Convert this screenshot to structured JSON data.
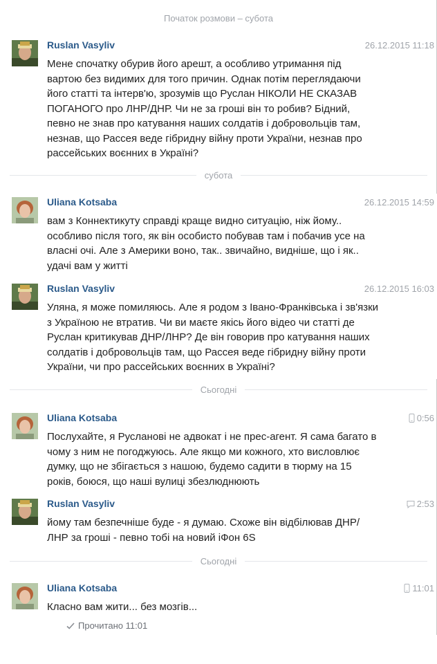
{
  "dividers": [
    "Початок розмови – субота",
    "субота",
    "Сьогодні",
    "Сьогодні"
  ],
  "messages": [
    {
      "sender": "Ruslan Vasyliv",
      "time": "26.12.2015 11:18",
      "text": "Мене спочатку обурив його арешт, а особливо утримання під\nвартою без видимих для того причин. Однак потім переглядаючи\nйого статті та інтерв'ю, зрозумів що Руслан НІКОЛИ НЕ СКАЗАВ\nПОГАНОГО про ЛНР/ДНР. Чи не за гроші він то робив? Бідний,\nпевно не знав про катування наших солдатів і добровольців там,\nнезнав, що Рассея веде гібридну війну проти України, незнав про\nрассейських воєнних в Україні?"
    },
    {
      "sender": "Uliana Kotsaba",
      "time": "26.12.2015 14:59",
      "text": "вам з Коннектикуту справді краще видно ситуацію, ніж йому..\nособливо після того, як він особисто побував там і побачив усе на\nвласні очі. Але з Америки воно, так.. звичайно, видніше, що і як..\nудачі вам у житті"
    },
    {
      "sender": "Ruslan Vasyliv",
      "time": "26.12.2015 16:03",
      "text": "Уляна, я може помиляюсь. Але я родом з Івано-Франківська і зв'язки\nз Україною не втратив. Чи ви маєте якісь його відео чи статті де\nРуслан критикував ДНР/ЛНР? Де він говорив про катування наших\nсолдатів і добровольців там, що Рассея веде гібридну війну проти\nУкраїни, чи про рассейських воєнних в Україні?"
    },
    {
      "sender": "Uliana Kotsaba",
      "time": "0:56",
      "text": "Послухайте, я Русланові не адвокат і не прес-агент. Я сама багато в\nчому з ним не погоджуюсь. Але якщо ми кожного,  хто висловлює\nдумку, що не збігається з нашою, будемо садити в тюрму на 15\nроків, боюся,  що наші вулиці збезлюднюють"
    },
    {
      "sender": "Ruslan Vasyliv",
      "time": "2:53",
      "text": "йому там безпечніше буде - я думаю. Схоже він відбілював ДНР/\nЛНР за гроші - певно тобі на новий iФон 6S"
    },
    {
      "sender": "Uliana Kotsaba",
      "time": "11:01",
      "text": "Класно вам жити... без мозгів..."
    }
  ],
  "read_receipt": "Прочитано 11:01"
}
